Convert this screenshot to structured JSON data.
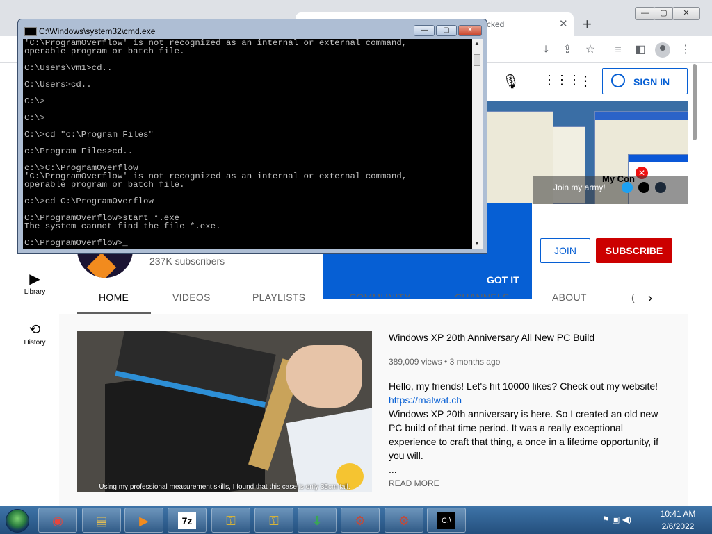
{
  "browser": {
    "tab_title": "cked",
    "tab_close": "✕",
    "new_tab": "+",
    "window_min": "—",
    "window_max": "▢",
    "window_close": "✕"
  },
  "youtube": {
    "sign_in": "SIGN IN",
    "banner_join": "Join my army!",
    "banner_mycomputer": "My Con",
    "got_it": "GOT IT",
    "join": "JOIN",
    "subscribe": "SUBSCRIBE",
    "subscribers": "237K subscribers",
    "tabs": [
      "HOME",
      "VIDEOS",
      "PLAYLISTS",
      "COMMUNITY",
      "CHANNELS",
      "ABOUT",
      "("
    ],
    "sidebar": [
      {
        "label": "Library",
        "icon": "library-icon"
      },
      {
        "label": "History",
        "icon": "history-icon"
      }
    ],
    "video": {
      "caption": "Using my professional measurement skills, I found that this case is only 35cm tall.",
      "title": "Windows XP 20th Anniversary All New PC Build",
      "meta": "389,009 views • 3 months ago",
      "desc_line1": "Hello, my friends! Let's hit 10000 likes? Check out my website!",
      "desc_link": "https://malwat.ch",
      "desc_body": "Windows XP 20th anniversary is here. So I created an old new PC build of that time period. It was a really exceptional experience to craft that thing, a once in a lifetime opportunity, if you will.",
      "desc_more": "...",
      "read_more": "READ MORE"
    }
  },
  "cmd": {
    "title": "C:\\Windows\\system32\\cmd.exe",
    "min": "—",
    "max": "▢",
    "close": "✕",
    "output": "'C:\\ProgramOverflow' is not recognized as an internal or external command,\noperable program or batch file.\n\nC:\\Users\\vm1>cd..\n\nC:\\Users>cd..\n\nC:\\>\n\nC:\\>\n\nC:\\>cd \"c:\\Program Files\"\n\nc:\\Program Files>cd..\n\nc:\\>C:\\ProgramOverflow\n'C:\\ProgramOverflow' is not recognized as an internal or external command,\noperable program or batch file.\n\nc:\\>cd C:\\ProgramOverflow\n\nC:\\ProgramOverflow>start *.exe\nThe system cannot find the file *.exe.\n\nC:\\ProgramOverflow>_"
  },
  "taskbar": {
    "items": [
      {
        "name": "chrome-taskbar-button",
        "glyph": "◉",
        "color": "#e8453c"
      },
      {
        "name": "explorer-taskbar-button",
        "glyph": "▤",
        "color": "#f3c64c"
      },
      {
        "name": "media-player-taskbar-button",
        "glyph": "▶",
        "color": "#f28b1e"
      },
      {
        "name": "7zip-taskbar-button",
        "glyph": "7z",
        "color": "#000000"
      },
      {
        "name": "keytool-taskbar-button-1",
        "glyph": "⚿",
        "color": "#d4b23a"
      },
      {
        "name": "keytool-taskbar-button-2",
        "glyph": "⚿",
        "color": "#d4b23a"
      },
      {
        "name": "installer-taskbar-button",
        "glyph": "⬇",
        "color": "#3aa655"
      },
      {
        "name": "setup-taskbar-button-1",
        "glyph": "⚙",
        "color": "#c24a3a"
      },
      {
        "name": "setup-taskbar-button-2",
        "glyph": "⚙",
        "color": "#c24a3a"
      },
      {
        "name": "cmd-taskbar-button",
        "glyph": "C:\\",
        "color": "#ffffff"
      }
    ],
    "time": "10:41 AM",
    "date": "2/6/2022",
    "tray": "⚑ ▣ ◀)"
  }
}
